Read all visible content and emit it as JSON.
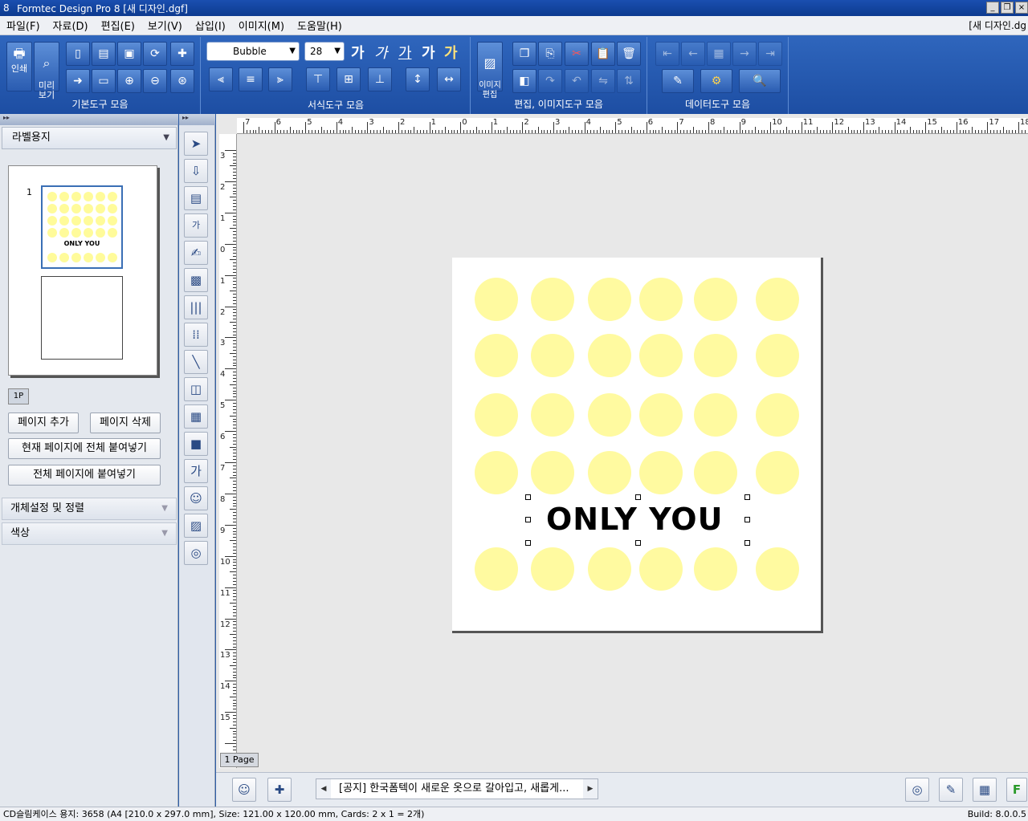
{
  "window": {
    "title": "Formtec Design Pro 8 [새 디자인.dgf]",
    "controls": [
      "_",
      "❐",
      "×"
    ]
  },
  "menu": {
    "items": [
      "파일(F)",
      "자료(D)",
      "편집(E)",
      "보기(V)",
      "삽입(I)",
      "이미지(M)",
      "도움말(H)"
    ],
    "doc_title": "[새 디자인.dg"
  },
  "ribbon": {
    "groups": [
      {
        "label": "기본도구 모음"
      },
      {
        "label": "서식도구 모음"
      },
      {
        "label": "편집, 이미지도구 모음"
      },
      {
        "label": "데이터도구 모음"
      }
    ],
    "print_label": "인쇄",
    "preview_label": "미리\n보기",
    "image_edit_label": "이미지\n편집",
    "font_name": "Bubble",
    "font_size": "28",
    "ga_glyph": "가"
  },
  "left_panel": {
    "combo_label": "라벨용지",
    "thumb_number": "1",
    "thumb_text": "ONLY YOU",
    "page_tab": "1P",
    "buttons": {
      "add_page": "페이지 추가",
      "delete_page": "페이지 삭제",
      "paste_current": "현재 페이지에 전체 붙여넣기",
      "paste_all": "전체 페이지에 붙여넣기"
    },
    "sections": [
      "개체설정 및 정렬",
      "색상"
    ]
  },
  "canvas": {
    "main_text": "ONLY YOU",
    "page_tab": "1 Page",
    "ruler_top_labels": [
      "7",
      "6",
      "5",
      "4",
      "3",
      "2",
      "1",
      "0",
      "1",
      "2",
      "3",
      "4",
      "5",
      "6",
      "7",
      "8",
      "9",
      "10",
      "11",
      "12",
      "13",
      "14",
      "15",
      "16",
      "17",
      "18"
    ],
    "ruler_left_labels": [
      "3",
      "2",
      "1",
      "0",
      "1",
      "2",
      "3",
      "4",
      "5",
      "6",
      "7",
      "8",
      "9",
      "10",
      "11",
      "12",
      "13",
      "14",
      "15"
    ],
    "dot_color": "#fffaa0"
  },
  "bottom": {
    "notice": "[공지] 한국폼텍이 새로운 옷으로 갈아입고, 새롭게..."
  },
  "status": {
    "text": "CD슬림케이스 용지: 3658 (A4 [210.0 x 297.0 mm], Size: 121.00 x 120.00 mm,  Cards: 2 x 1 = 2개)",
    "build": "Build: 8.0.0.5"
  }
}
